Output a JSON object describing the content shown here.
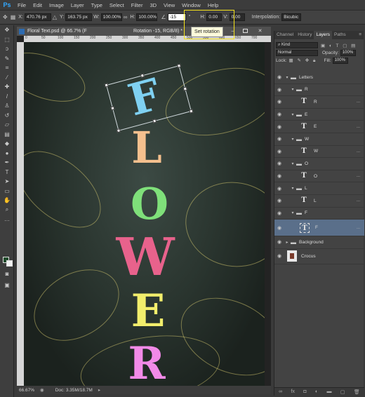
{
  "app": {
    "logo": "Ps"
  },
  "menu": [
    "File",
    "Edit",
    "Image",
    "Layer",
    "Type",
    "Select",
    "Filter",
    "3D",
    "View",
    "Window",
    "Help"
  ],
  "options": {
    "x_label": "X:",
    "x_value": "470.76 px",
    "y_label": "Y:",
    "y_value": "163.75 px",
    "w_label": "W:",
    "w_value": "100.00%",
    "h_label": "H:",
    "h_value": "100.00%",
    "rotation_value": "-15",
    "hskew_label": "H:",
    "hskew_value": "0.00",
    "vskew_label": "V:",
    "vskew_value": "0.00",
    "interp_label": "Interpolation:",
    "interp_value": "Bicubic"
  },
  "tooltip": "Set rotation",
  "document": {
    "tab_title": "Floral Text.psd @ 66.7% (F",
    "tab_title_right": "Rotation -15, RGB/8) *",
    "zoom": "66.67%",
    "doc_size": "Doc: 3.35M/18.7M",
    "ruler_marks": [
      "0",
      "50",
      "100",
      "150",
      "200",
      "250",
      "300",
      "350",
      "400",
      "450",
      "500",
      "550",
      "600",
      "650",
      "700"
    ]
  },
  "letters": [
    {
      "char": "F",
      "color": "#7fd1f2"
    },
    {
      "char": "L",
      "color": "#f5c08e"
    },
    {
      "char": "O",
      "color": "#7fe07a"
    },
    {
      "char": "W",
      "color": "#e8628c"
    },
    {
      "char": "E",
      "color": "#f2ee6c"
    },
    {
      "char": "R",
      "color": "#f28ae8"
    }
  ],
  "panel": {
    "tabs": [
      "Channel",
      "History",
      "Layers",
      "Paths"
    ],
    "kind_label": "Kind",
    "blend_mode": "Normal",
    "opacity_label": "Opacity:",
    "opacity_value": "100%",
    "lock_label": "Lock:",
    "fill_label": "Fill:",
    "fill_value": "100%",
    "layers": [
      {
        "name": "Letters",
        "type": "group"
      },
      {
        "name": "R",
        "type": "group"
      },
      {
        "name": "R",
        "type": "text"
      },
      {
        "name": "E",
        "type": "group"
      },
      {
        "name": "E",
        "type": "text"
      },
      {
        "name": "W",
        "type": "group"
      },
      {
        "name": "W",
        "type": "text"
      },
      {
        "name": "O",
        "type": "group"
      },
      {
        "name": "O",
        "type": "text"
      },
      {
        "name": "L",
        "type": "group"
      },
      {
        "name": "L",
        "type": "text"
      },
      {
        "name": "F",
        "type": "group"
      },
      {
        "name": "F",
        "type": "text"
      },
      {
        "name": "Background",
        "type": "group"
      },
      {
        "name": "Crocus",
        "type": "image"
      }
    ]
  }
}
